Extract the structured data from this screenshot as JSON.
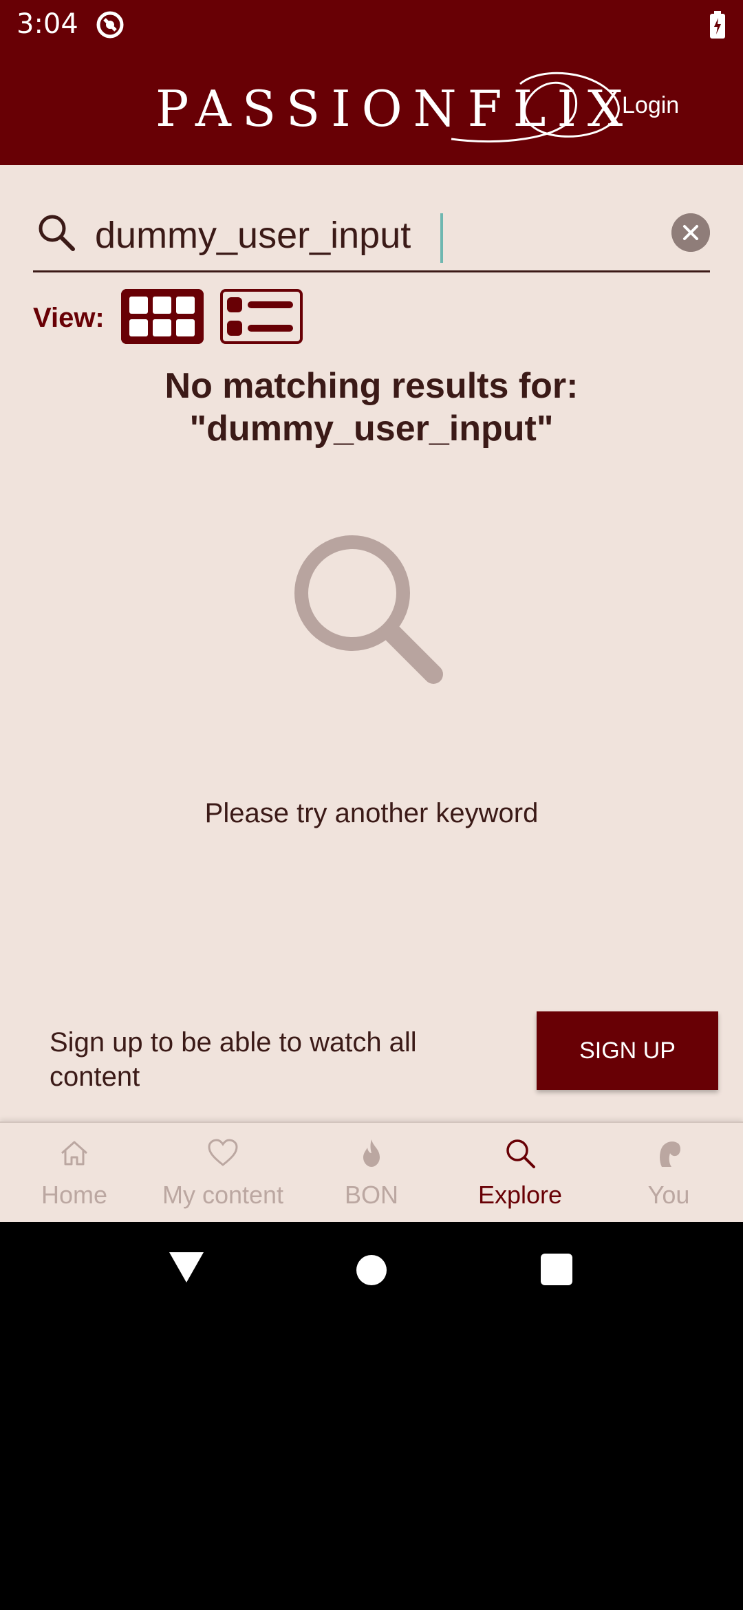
{
  "status_bar": {
    "time": "3:04",
    "icons": [
      "app-notification-icon",
      "battery-charging-icon"
    ]
  },
  "header": {
    "logo_text": "PASSIONFLIX",
    "login_label": "Login",
    "background_color": "#680005"
  },
  "search": {
    "value": "dummy_user_input",
    "icon": "search-icon",
    "clear_icon": "clear-icon"
  },
  "view": {
    "label": "View:",
    "options": [
      "grid-view-icon",
      "list-view-icon"
    ],
    "selected": "grid"
  },
  "results": {
    "title_line1": "No matching results for:",
    "title_line2": "\"dummy_user_input\"",
    "empty_icon": "search-icon",
    "hint": "Please try another keyword"
  },
  "signup": {
    "text": "Sign up to be able to watch all content",
    "button_label": "SIGN UP"
  },
  "bottom_nav": {
    "items": [
      {
        "label": "Home",
        "icon": "home-icon"
      },
      {
        "label": "My content",
        "icon": "heart-icon"
      },
      {
        "label": "BON",
        "icon": "flame-icon"
      },
      {
        "label": "Explore",
        "icon": "search-icon",
        "active": true
      },
      {
        "label": "You",
        "icon": "profile-icon"
      }
    ]
  },
  "colors": {
    "brand": "#680005",
    "background": "#f0e3dc",
    "text": "#3b1a17",
    "inactive": "#bba7a1"
  }
}
